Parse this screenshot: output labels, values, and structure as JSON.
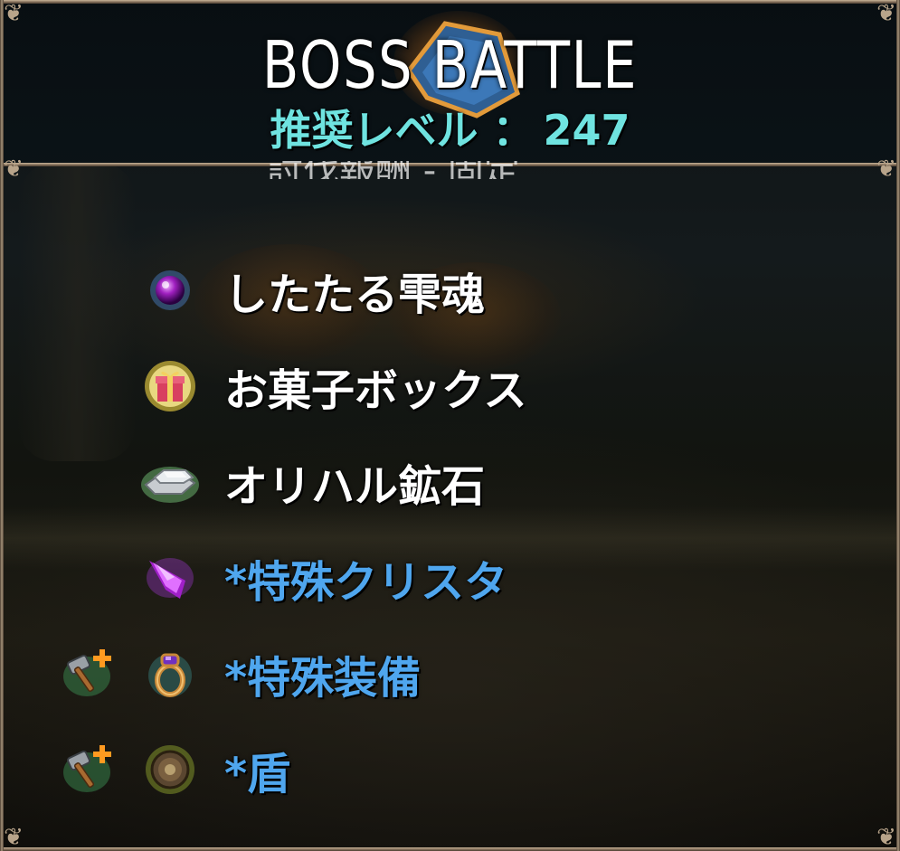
{
  "header": {
    "title": "BOSS BATTLE",
    "recommended_level_label": "推奨レベル ：",
    "recommended_level_value": "247",
    "hidden_line_partial": "討伐報酬 - 固定"
  },
  "colors": {
    "frame": "#c9b59a",
    "level_text": "#6fe3e0",
    "normal_item_text": "#ffffff",
    "special_item_text": "#4fa6ee"
  },
  "rewards": [
    {
      "label": "したたる雫魂",
      "icon": "purple-orb-icon",
      "upgradeable": false,
      "special": false
    },
    {
      "label": "お菓子ボックス",
      "icon": "gift-box-icon",
      "upgradeable": false,
      "special": false
    },
    {
      "label": "オリハル鉱石",
      "icon": "ore-ingot-icon",
      "upgradeable": false,
      "special": false
    },
    {
      "label": "*特殊クリスタ",
      "icon": "crystal-icon",
      "upgradeable": false,
      "special": true
    },
    {
      "label": "*特殊装備",
      "icon": "ring-icon",
      "upgradeable": true,
      "special": true
    },
    {
      "label": "*盾",
      "icon": "shield-icon",
      "upgradeable": true,
      "special": true
    }
  ]
}
